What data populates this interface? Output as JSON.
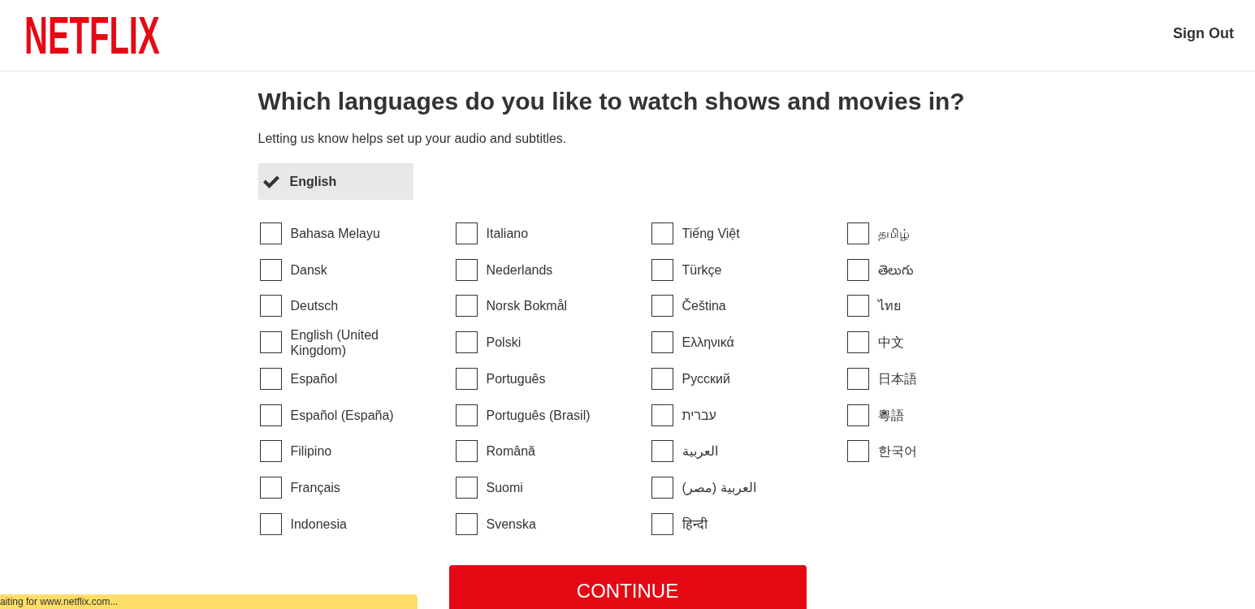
{
  "header": {
    "logo": "NETFLIX",
    "sign_out": "Sign Out"
  },
  "heading": "Which languages do you like to watch shows and movies in?",
  "subtitle": "Letting us know helps set up your audio and subtitles.",
  "primary_language": {
    "label": "English",
    "selected": true
  },
  "languages": [
    {
      "label": "Bahasa Melayu",
      "checked": false
    },
    {
      "label": "Dansk",
      "checked": false
    },
    {
      "label": "Deutsch",
      "checked": false
    },
    {
      "label": "English (United Kingdom)",
      "checked": false
    },
    {
      "label": "Español",
      "checked": false
    },
    {
      "label": "Español (España)",
      "checked": false
    },
    {
      "label": "Filipino",
      "checked": false
    },
    {
      "label": "Français",
      "checked": false
    },
    {
      "label": "Indonesia",
      "checked": false
    },
    {
      "label": "Italiano",
      "checked": false
    },
    {
      "label": "Nederlands",
      "checked": false
    },
    {
      "label": "Norsk Bokmål",
      "checked": false
    },
    {
      "label": "Polski",
      "checked": false
    },
    {
      "label": "Português",
      "checked": false
    },
    {
      "label": "Português (Brasil)",
      "checked": false
    },
    {
      "label": "Română",
      "checked": false
    },
    {
      "label": "Suomi",
      "checked": false
    },
    {
      "label": "Svenska",
      "checked": false
    },
    {
      "label": "Tiếng Việt",
      "checked": false
    },
    {
      "label": "Türkçe",
      "checked": false
    },
    {
      "label": "Čeština",
      "checked": false
    },
    {
      "label": "Ελληνικά",
      "checked": false
    },
    {
      "label": "Русский",
      "checked": false
    },
    {
      "label": "עברית",
      "checked": false
    },
    {
      "label": "العربية",
      "checked": false
    },
    {
      "label": "العربية (مصر)",
      "checked": false
    },
    {
      "label": "हिन्दी",
      "checked": false
    },
    {
      "label": "தமிழ்",
      "checked": false
    },
    {
      "label": "తెలుగు",
      "checked": false
    },
    {
      "label": "ไทย",
      "checked": false
    },
    {
      "label": "中文",
      "checked": false
    },
    {
      "label": "日本語",
      "checked": false
    },
    {
      "label": "粵語",
      "checked": false
    },
    {
      "label": "한국어",
      "checked": false
    }
  ],
  "continue_button": "CONTINUE",
  "status_bar": "aiting for www.netflix.com..."
}
